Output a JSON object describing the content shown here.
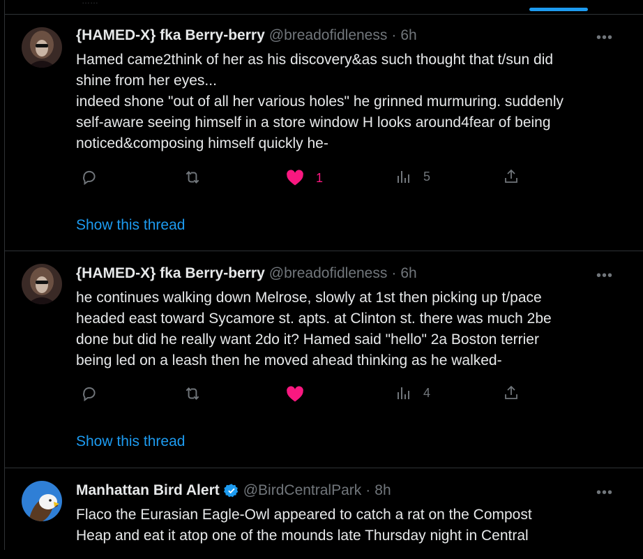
{
  "top": {
    "faint_text": "……"
  },
  "tweets": [
    {
      "name": "{HAMED-X} fka Berry-berry",
      "handle": "@breadofidleness",
      "dot": "·",
      "time": "6h",
      "more": "•••",
      "lines": [
        "Hamed came2think of her as his discovery&as such thought that t/sun did",
        "shine from her eyes...",
        "indeed shone \"out of all her various holes\" he grinned murmuring. suddenly",
        "self-aware seeing himself in a store window H looks around4fear of being",
        "noticed&composing himself quickly he-"
      ],
      "likes": "1",
      "views": "5",
      "show_thread": "Show this thread",
      "like_color": "#f91880"
    },
    {
      "name": "{HAMED-X} fka Berry-berry",
      "handle": "@breadofidleness",
      "dot": "·",
      "time": "6h",
      "more": "•••",
      "lines": [
        "he continues walking down Melrose, slowly at 1st then picking up t/pace",
        "headed east toward Sycamore st. apts. at Clinton st. there was much 2be",
        "done but did he really want 2do it? Hamed said \"hello\" 2a Boston terrier",
        "being led on a leash then he moved ahead thinking as he walked-"
      ],
      "likes": "",
      "views": "4",
      "show_thread": "Show this thread"
    },
    {
      "name": "Manhattan Bird Alert",
      "handle": "@BirdCentralPark",
      "dot": "·",
      "time": "8h",
      "more": "•••",
      "lines": [
        "Flaco the Eurasian Eagle-Owl appeared to catch a rat on the Compost",
        "Heap and eat it atop one of the mounds late Thursday night in Central"
      ],
      "verified_color": "#1d9bf0"
    }
  ],
  "icons": [
    "reply-icon",
    "retweet-icon",
    "heart-icon",
    "views-icon",
    "share-icon",
    "verified-badge-icon",
    "more-icon"
  ]
}
